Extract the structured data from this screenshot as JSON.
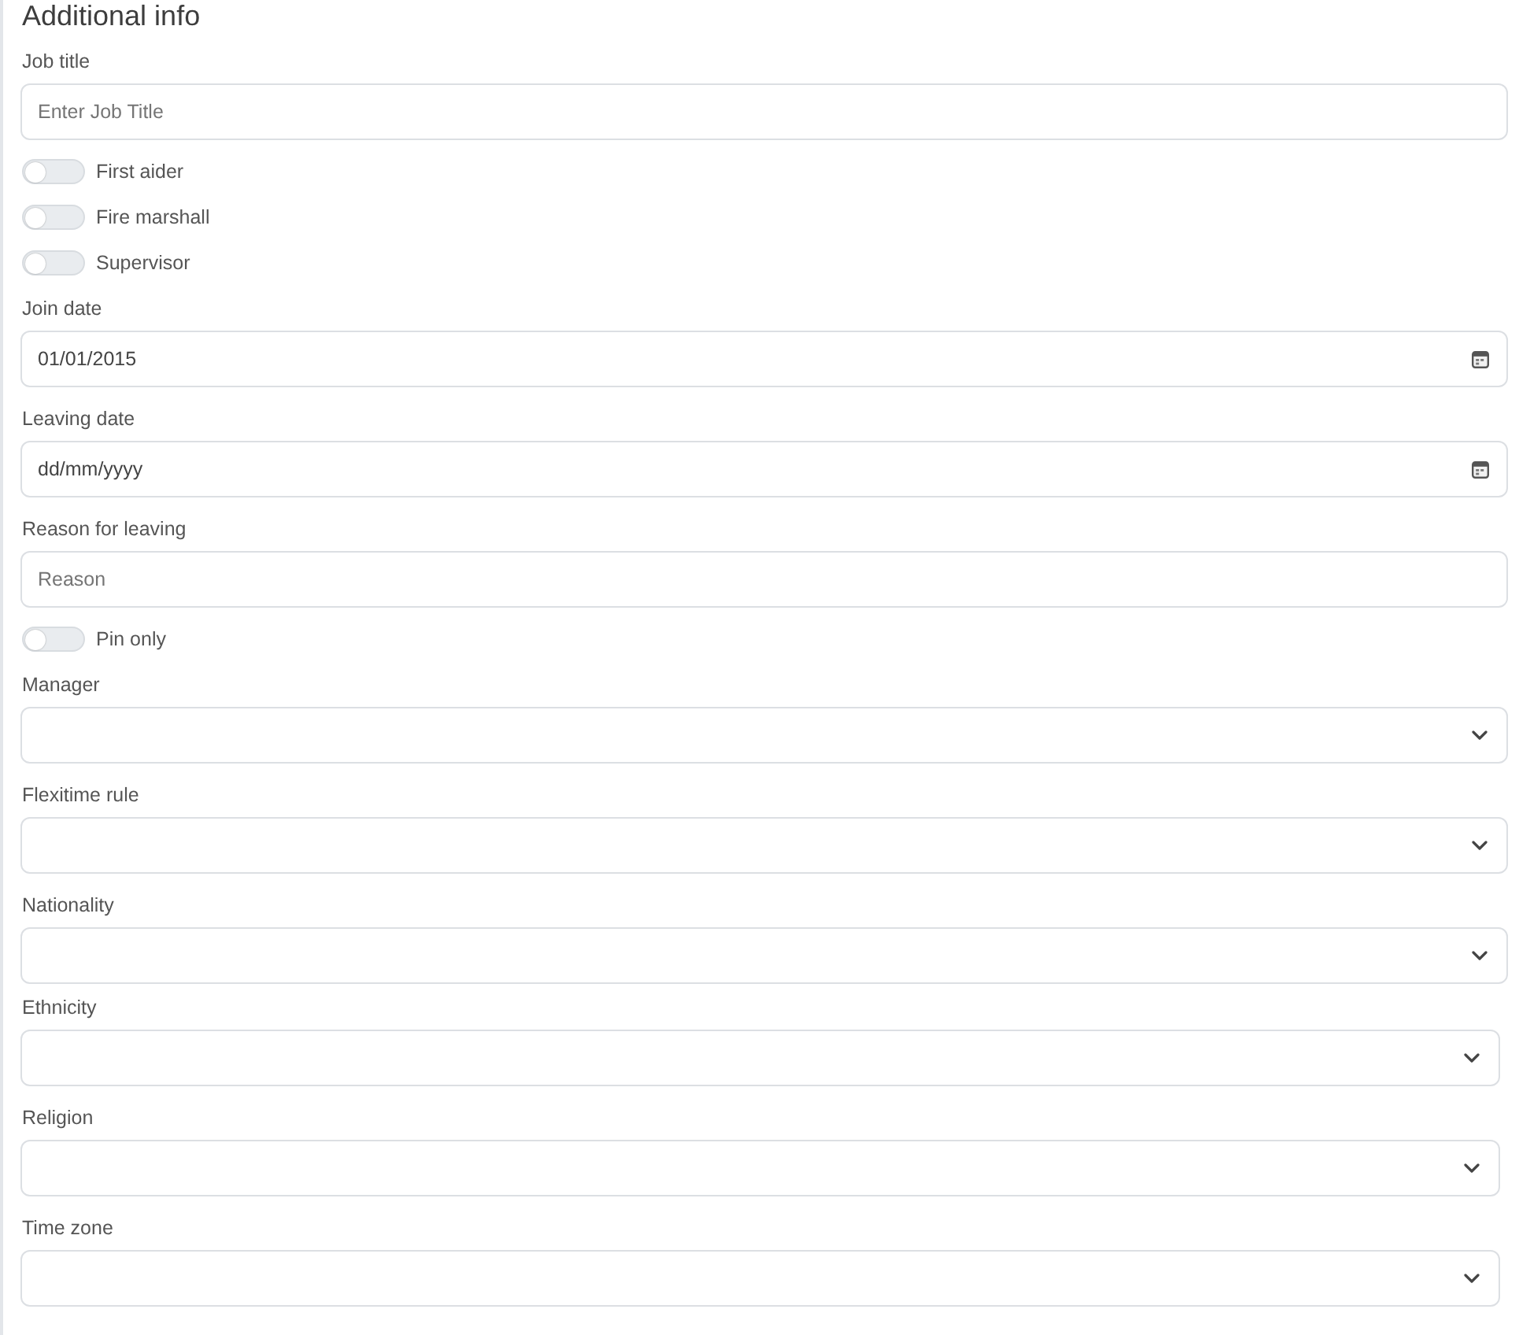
{
  "section": {
    "title": "Additional info"
  },
  "fields": [
    {
      "kind": "text",
      "label": "Job title",
      "placeholder": "Enter Job Title"
    },
    {
      "kind": "toggle",
      "label": "First aider",
      "on": false
    },
    {
      "kind": "toggle",
      "label": "Fire marshall",
      "on": false
    },
    {
      "kind": "toggle",
      "label": "Supervisor",
      "on": false
    },
    {
      "kind": "date",
      "label": "Join date",
      "value": "01/01/2015"
    },
    {
      "kind": "date",
      "label": "Leaving date",
      "placeholder": "dd/mm/yyyy"
    },
    {
      "kind": "text",
      "label": "Reason for leaving",
      "placeholder": "Reason"
    },
    {
      "kind": "toggle",
      "label": "Pin only",
      "on": false
    },
    {
      "kind": "select",
      "label": "Manager"
    },
    {
      "kind": "select",
      "label": "Flexitime rule"
    },
    {
      "kind": "select",
      "label": "Nationality"
    },
    {
      "kind": "select",
      "label": "Ethnicity"
    },
    {
      "kind": "select",
      "label": "Religion"
    },
    {
      "kind": "select",
      "label": "Time zone"
    }
  ]
}
